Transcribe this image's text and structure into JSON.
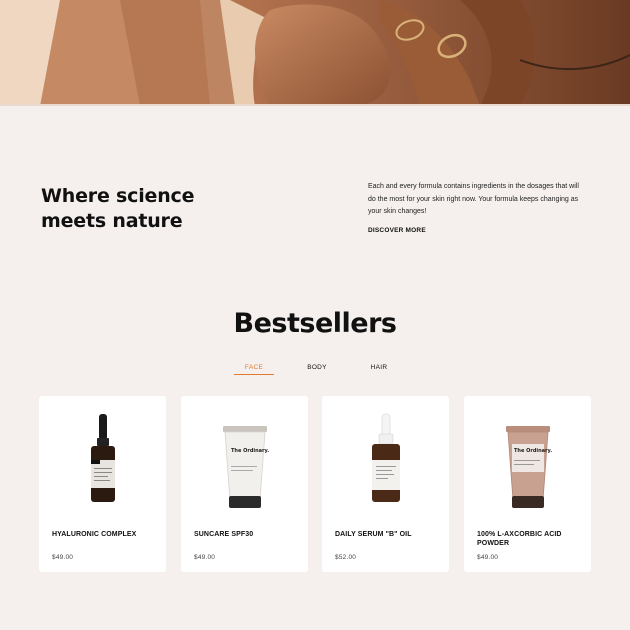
{
  "intro": {
    "title": "Where science meets nature",
    "text": "Each and every formula contains ingredients in the dosages that will do the most for your skin right now. Your formula keeps changing as your skin changes!",
    "cta": "DISCOVER MORE"
  },
  "bestsellers": {
    "title": "Bestsellers",
    "tabs": [
      {
        "label": "FACE",
        "active": true
      },
      {
        "label": "BODY",
        "active": false
      },
      {
        "label": "HAIR",
        "active": false
      }
    ],
    "products": [
      {
        "name": "HYALURONIC COMPLEX",
        "price": "$49.00",
        "image": "dropper-bottle-dark-label"
      },
      {
        "name": "SUNCARE  SPF30",
        "price": "$49.00",
        "image": "white-tube"
      },
      {
        "name": "DAILY SERUM  \"B\" OIL",
        "price": "$52.00",
        "image": "dropper-bottle-white-label"
      },
      {
        "name": "100% L-AXCORBIC ACID POWDER",
        "price": "$49.00",
        "image": "rose-tube"
      }
    ],
    "product_label_brand": "The Ordinary.",
    "accent_color": "#e07a2e"
  }
}
